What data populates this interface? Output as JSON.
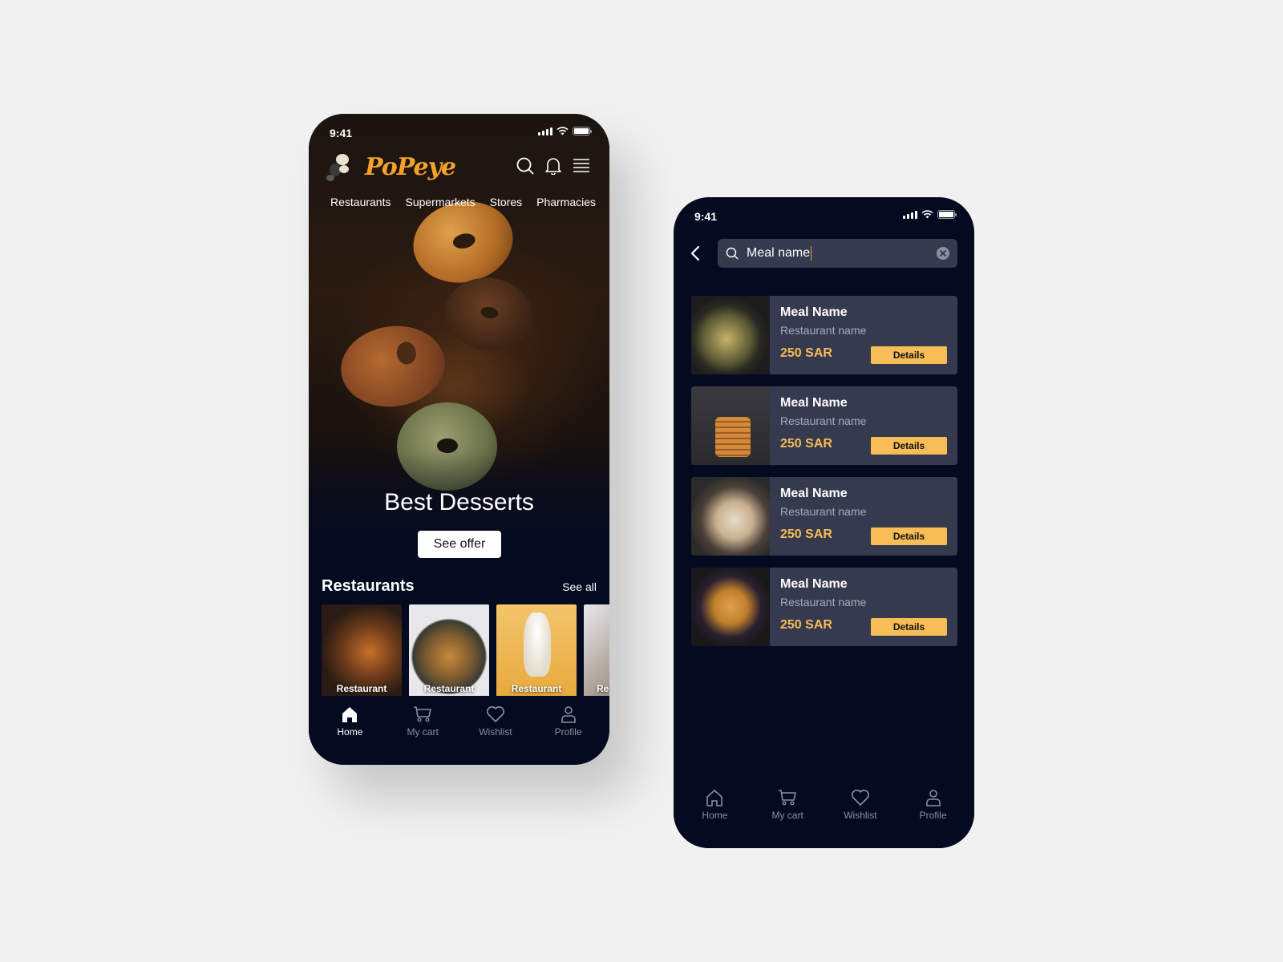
{
  "colors": {
    "background": "#f1f1f1",
    "phone_bg": "#040a1f",
    "brand_orange": "#f3a22c",
    "accent_yellow": "#f7bd56",
    "card_bg": "#363a4f"
  },
  "home": {
    "status": {
      "time": "9:41"
    },
    "logo": {
      "text": "PoPeye"
    },
    "header_icons": [
      "search-icon",
      "bell-icon",
      "menu-icon"
    ],
    "categories": [
      "Restaurants",
      "Supermarkets",
      "Stores",
      "Pharmacies"
    ],
    "hero": {
      "title": "Best Desserts",
      "button": "See offer"
    },
    "restaurants": {
      "title": "Restaurants",
      "see_all": "See all",
      "cards": [
        {
          "label": "Restaurant"
        },
        {
          "label": "Restaurant"
        },
        {
          "label": "Restaurant"
        },
        {
          "label": "Re"
        }
      ]
    },
    "tabs": [
      {
        "label": "Home",
        "icon": "home-icon",
        "active": true
      },
      {
        "label": "My cart",
        "icon": "cart-icon",
        "active": false
      },
      {
        "label": "Wishlist",
        "icon": "heart-icon",
        "active": false
      },
      {
        "label": "Profile",
        "icon": "user-icon",
        "active": false
      }
    ]
  },
  "search": {
    "status": {
      "time": "9:41"
    },
    "search_value": "Meal name",
    "results": [
      {
        "name": "Meal Name",
        "restaurant": "Restaurant name",
        "price": "250 SAR",
        "button": "Details"
      },
      {
        "name": "Meal Name",
        "restaurant": "Restaurant name",
        "price": "250 SAR",
        "button": "Details"
      },
      {
        "name": "Meal Name",
        "restaurant": "Restaurant name",
        "price": "250 SAR",
        "button": "Details"
      },
      {
        "name": "Meal Name",
        "restaurant": "Restaurant name",
        "price": "250 SAR",
        "button": "Details"
      }
    ],
    "tabs": [
      {
        "label": "Home",
        "icon": "home-icon",
        "active": false
      },
      {
        "label": "My cart",
        "icon": "cart-icon",
        "active": false
      },
      {
        "label": "Wishlist",
        "icon": "heart-icon",
        "active": false
      },
      {
        "label": "Profile",
        "icon": "user-icon",
        "active": false
      }
    ]
  }
}
